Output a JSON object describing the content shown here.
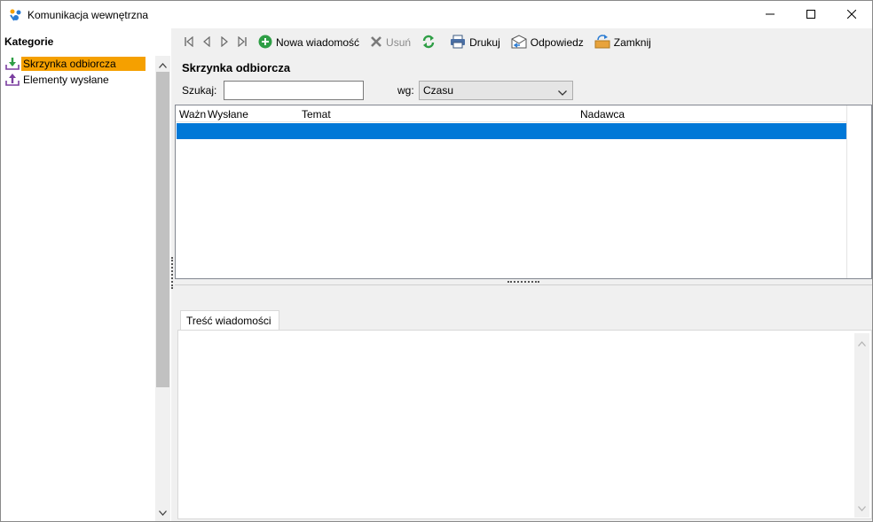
{
  "window": {
    "title": "Komunikacja wewnętrzna",
    "controls": {
      "minimize": "minimize",
      "maximize": "maximize",
      "close": "close"
    }
  },
  "sidebar": {
    "header": "Kategorie",
    "items": [
      {
        "label": "Skrzynka odbiorcza",
        "icon": "inbox-download-icon",
        "selected": true
      },
      {
        "label": "Elementy wysłane",
        "icon": "sent-upload-icon",
        "selected": false
      }
    ]
  },
  "toolbar": {
    "nav": [
      "first-record-icon",
      "previous-record-icon",
      "next-record-icon",
      "last-record-icon"
    ],
    "new_message": "Nowa wiadomość",
    "delete": "Usuń",
    "print": "Drukuj",
    "reply": "Odpowiedz",
    "close": "Zamknij"
  },
  "list": {
    "title": "Skrzynka odbiorcza",
    "search_label": "Szukaj:",
    "search_value": "",
    "sort_label": "wg:",
    "sort_value": "Czasu",
    "columns": [
      "Ważn",
      "Wysłane",
      "Temat",
      "Nadawca"
    ],
    "rows": []
  },
  "detail": {
    "tab_label": "Treść wiadomości",
    "content": ""
  },
  "colors": {
    "selected_category": "#f5a000",
    "selected_row": "#0078d7",
    "accent_green": "#2e9e45"
  }
}
